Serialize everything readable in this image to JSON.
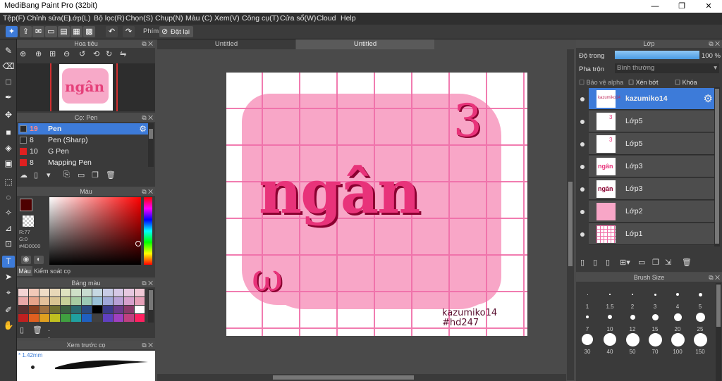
{
  "app": {
    "title": "MediBang Paint Pro (32bit)",
    "min": "—",
    "max": "❐",
    "close": "✕"
  },
  "menu": [
    "Tệp(F)",
    "Chỉnh sửa(E)",
    "Lớp(L)",
    "Bộ lọc(R)",
    "Chọn(S)",
    "Chụp(N)",
    "Màu (C)",
    "Xem(V)",
    "Công cụ(T)",
    "Cửa sổ(W)",
    "Cloud",
    "Help"
  ],
  "toolbar": {
    "phim_label": "Phím",
    "reset_label": "Đặt lại"
  },
  "navigator": {
    "title": "Hoa tiêu"
  },
  "brush_panel": {
    "title": "Cọ: Pen",
    "items": [
      {
        "size": "19",
        "name": "Pen",
        "color": "#2a2a2a"
      },
      {
        "size": "8",
        "name": "Pen (Sharp)",
        "color": "#2a2a2a"
      },
      {
        "size": "10",
        "name": "G Pen",
        "color": "#e02020"
      },
      {
        "size": "8",
        "name": "Mapping Pen",
        "color": "#e02020"
      }
    ]
  },
  "color_panel": {
    "title": "Màu",
    "r": "R:77",
    "g": "G:0",
    "hex": "#4D0000",
    "tab1": "Màu",
    "tab2": "Kiểm soát cọ",
    "fg": "#4d0000"
  },
  "palette": {
    "title": "Bảng màu",
    "dash": "---"
  },
  "brush_preview": {
    "title": "Xem trước cọ",
    "size": "* 1.42mm"
  },
  "tabs": [
    "Untitled",
    "Untitled"
  ],
  "artwork": {
    "main_text": "ngân",
    "signature_line1": "kazumiko14",
    "signature_line2": "#hd247"
  },
  "layers_panel": {
    "title": "Lớp",
    "opacity_label": "Độ trong",
    "opacity_value": "100 %",
    "opacity": 1.0,
    "blend_label": "Pha trộn",
    "blend_value": "Bình thường",
    "protect_alpha": "Bảo vệ alpha",
    "clip": "Xén bớt",
    "lock": "Khóa",
    "layers": [
      "kazumiko14",
      "Lớp5",
      "Lớp5",
      "Lớp3",
      "Lớp3",
      "Lớp2",
      "Lớp1"
    ]
  },
  "brush_size": {
    "title": "Brush Size",
    "sizes": [
      "1",
      "1.5",
      "2",
      "3",
      "4",
      "5",
      "7",
      "10",
      "12",
      "15",
      "20",
      "25",
      "30",
      "40",
      "50",
      "70",
      "100",
      "150"
    ]
  }
}
